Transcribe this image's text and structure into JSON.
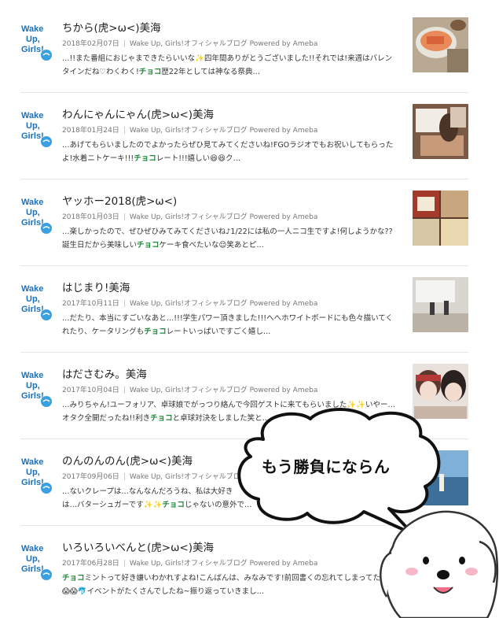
{
  "entries": [
    {
      "title": "ちから(虎>ω<)美海",
      "date": "2018年02月07日",
      "blog": "Wake Up, Girls!オフィシャルブログ Powered by Ameba",
      "snippet_before": "…!!また番組におじゃまできたらいいな",
      "snippet_mid1": "四年間ありがとうございました!!それでは!来週はバレンタインだね♡わくわく!",
      "keyword": "チョコ",
      "snippet_after": "歴22年としては神なる祭典…"
    },
    {
      "title": "わんにゃんにゃん(虎>ω<)美海",
      "date": "2018年01月24日",
      "blog": "Wake Up, Girls!オフィシャルブログ Powered by Ameba",
      "snippet_before": "…あげてもらいましたのでよかったらぜひ見てみてくださいね!FGOラジオでもお祝いしてもらったよ!水着ニトケーキ!!!",
      "snippet_mid1": "",
      "keyword": "チョコ",
      "snippet_after": "レート!!!嬉しい😆😆ク…"
    },
    {
      "title": "ヤッホー2018(虎>ω<)",
      "date": "2018年01月03日",
      "blog": "Wake Up, Girls!オフィシャルブログ Powered by Ameba",
      "snippet_before": "…楽しかったので、ぜひぜひみてみてくださいね♪1/22には私の一人ニコ生ですよ!何しようかな??誕生日だから美味しい",
      "snippet_mid1": "",
      "keyword": "チョコ",
      "snippet_after": "ケーキ食べたいな😌笑あとピ…"
    },
    {
      "title": "はじまり!美海",
      "date": "2017年10月11日",
      "blog": "Wake Up, Girls!オフィシャルブログ Powered by Ameba",
      "snippet_before": "…だたり、本当にすごいなあと…!!!学生パワー頂きました!!!へへホワイトボードにも色々描いてくれたり、ケータリングも",
      "snippet_mid1": "",
      "keyword": "チョコ",
      "snippet_after": "レートいっぱいですごく嬉し…"
    },
    {
      "title": "はださむみ。美海",
      "date": "2017年10月04日",
      "blog": "Wake Up, Girls!オフィシャルブログ Powered by Ameba",
      "snippet_before": "…みりちゃん!ユーフォリア、卓球娘でがっつり絡んで今回ゲストに来てもらいました",
      "snippet_mid1": "いやー… オタク全開だったね!!利き",
      "keyword": "チョコ",
      "snippet_after": "と卓球対決をしました笑と…"
    },
    {
      "title": "のんのんのん(虎>ω<)美海",
      "date": "2017年09月06日",
      "blog": "Wake Up, Girls!オフィシャルブログ Powered by Ameba",
      "snippet_before": "…ないクレープは…なんなんだろうね、私は大好き",
      "snippet_mid1": "は…バターシュガーです",
      "keyword": "チョコ",
      "snippet_after": "じゃないの意外で…"
    },
    {
      "title": "いろいろいべんと(虎>ω<)美海",
      "date": "2017年06月28日",
      "blog": "Wake Up, Girls!オフィシャルブログ Powered by Ameba",
      "snippet_before": "",
      "snippet_mid1": "",
      "keyword": "チョコ",
      "snippet_after": "ミントって好き嫌いわかれすよね!こんばんは、みなみです!前回書くの忘れてしまってたのだ😱😱🐬イベントがたくさんでしたね~振り返っていきまし…"
    }
  ],
  "logo_text": [
    "Wake",
    "Up,",
    "Girls!"
  ],
  "speech_bubble": "もう勝負にならん",
  "colors": {
    "keyword": "#1f8a3b",
    "logo_blue": "#1d6fb8",
    "divider": "#e6e6e6"
  }
}
